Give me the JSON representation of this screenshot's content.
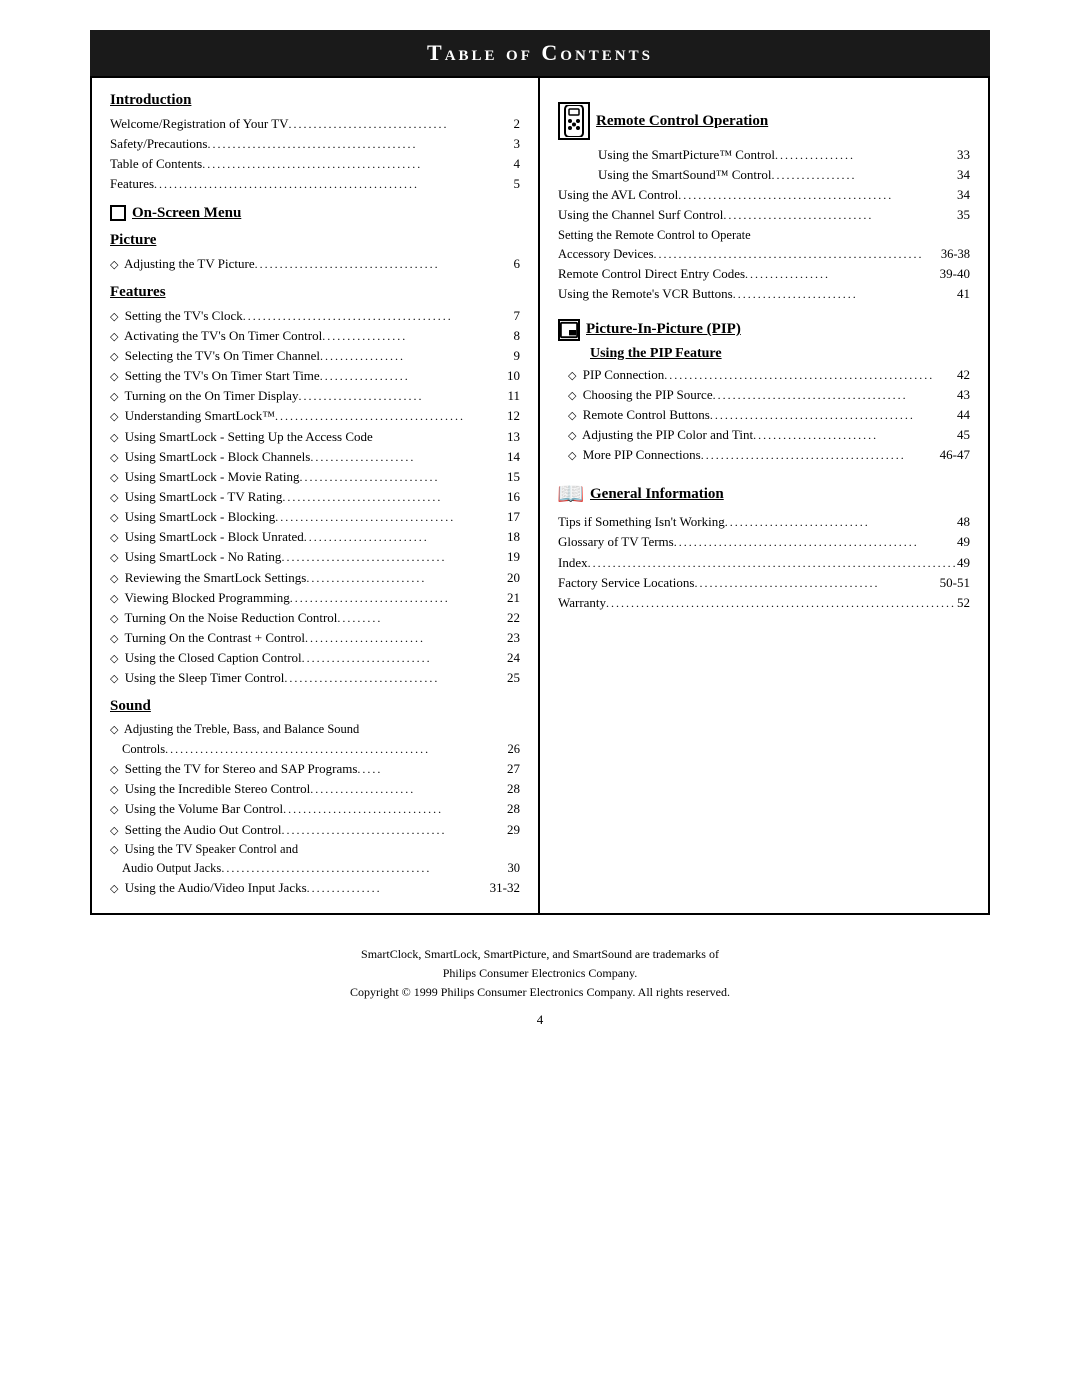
{
  "title": "Table of Contents",
  "left_column": {
    "introduction": {
      "heading": "Introduction",
      "entries": [
        {
          "text": "Welcome/Registration of Your TV",
          "dots": "................................",
          "page": "2"
        },
        {
          "text": "Safety/Precautions",
          "dots": "................................................",
          "page": "3"
        },
        {
          "text": "Table of Contents",
          "dots": "...................................................",
          "page": "4"
        },
        {
          "text": "Features",
          "dots": "................................................................",
          "page": "5"
        }
      ]
    },
    "on_screen_menu": {
      "heading": "On-Screen Menu"
    },
    "picture": {
      "heading": "Picture",
      "entries": [
        {
          "text": "◇ Adjusting the TV Picture",
          "dots": "......................................",
          "page": "6"
        }
      ]
    },
    "features": {
      "heading": "Features",
      "entries": [
        {
          "text": "◇ Setting the TV's Clock",
          "dots": "..........................................",
          "page": "7"
        },
        {
          "text": "◇ Activating the TV's On Timer Control",
          "dots": ".................",
          "page": "8"
        },
        {
          "text": "◇ Selecting the TV's On Timer Channel",
          "dots": "..................",
          "page": "9"
        },
        {
          "text": "◇ Setting the TV's On Timer Start Time",
          "dots": ".................",
          "page": "10"
        },
        {
          "text": "◇ Turning on the On Timer Display",
          "dots": ".........................",
          "page": "11"
        },
        {
          "text": "◇ Understanding SmartLock™",
          "dots": "......................................",
          "page": "12"
        },
        {
          "text": "◇ Using SmartLock - Setting Up the Access Code",
          "dots": "",
          "page": "13"
        },
        {
          "text": "◇ Using SmartLock - Block Channels",
          "dots": ".....................",
          "page": "14"
        },
        {
          "text": "◇ Using SmartLock - Movie Rating",
          "dots": "............................",
          "page": "15"
        },
        {
          "text": "◇ Using SmartLock - TV Rating",
          "dots": "................................",
          "page": "16"
        },
        {
          "text": "◇ Using SmartLock - Blocking",
          "dots": "....................................",
          "page": "17"
        },
        {
          "text": "◇ Using SmartLock - Block Unrated",
          "dots": ".........................",
          "page": "18"
        },
        {
          "text": "◇ Using SmartLock - No Rating",
          "dots": ".................................",
          "page": "19"
        },
        {
          "text": "◇ Reviewing the SmartLock Settings",
          "dots": "........................",
          "page": "20"
        },
        {
          "text": "◇ Viewing Blocked Programming",
          "dots": "................................",
          "page": "21"
        },
        {
          "text": "◇ Turning On the Noise Reduction Control",
          "dots": ".........",
          "page": "22"
        },
        {
          "text": "◇ Turning On the Contrast + Control",
          "dots": "........................",
          "page": "23"
        },
        {
          "text": "◇ Using the Closed Caption Control",
          "dots": "..........................",
          "page": "24"
        },
        {
          "text": "◇ Using the Sleep Timer Control",
          "dots": "...............................",
          "page": "25"
        }
      ]
    },
    "sound": {
      "heading": "Sound",
      "entries": [
        {
          "text": "◇ Adjusting the Treble, Bass, and Balance Sound Controls",
          "dots": "....",
          "page": "26",
          "multiline": true,
          "line2": "Controls"
        },
        {
          "text": "◇ Setting the TV for Stereo and SAP Programs",
          "dots": ".....",
          "page": "27"
        },
        {
          "text": "◇ Using the Incredible Stereo Control",
          "dots": ".....................",
          "page": "28"
        },
        {
          "text": "◇ Using the Volume Bar Control",
          "dots": "................................",
          "page": "28"
        },
        {
          "text": "◇ Setting the Audio Out Control",
          "dots": ".................................",
          "page": "29"
        },
        {
          "text": "◇ Using the TV Speaker Control and Audio Output Jacks",
          "dots": "......",
          "page": "30",
          "multiline": true,
          "line2": "Audio Output Jacks"
        },
        {
          "text": "◇ Using the Audio/Video Input Jacks",
          "dots": "...............",
          "page": "31-32"
        }
      ]
    }
  },
  "right_column": {
    "remote_control": {
      "heading": "Remote Control Operation",
      "entries": [
        {
          "text": "Using the SmartPicture™ Control",
          "dots": "................",
          "page": "33"
        },
        {
          "text": "Using the SmartSound™ Control",
          "dots": "...................",
          "page": "34"
        },
        {
          "text": "Using the AVL Control",
          "dots": "...........................................",
          "page": "34"
        },
        {
          "text": "Using the Channel Surf Control",
          "dots": "..............................",
          "page": "35"
        },
        {
          "text": "Setting the Remote Control to Operate Accessory Devices",
          "dots": "....",
          "page": "36-38",
          "multiline": true,
          "line2": "Accessory Devices"
        },
        {
          "text": "Remote Control Direct Entry Codes",
          "dots": "...................",
          "page": "39-40"
        },
        {
          "text": "Using the Remote's VCR Buttons",
          "dots": ".........................",
          "page": "41"
        }
      ]
    },
    "pip": {
      "heading": "Picture-In-Picture (PIP)",
      "sub_heading": "Using the PIP Feature",
      "entries": [
        {
          "text": "◇ PIP Connection",
          "dots": "......................................................",
          "page": "42"
        },
        {
          "text": "◇ Choosing the PIP Source",
          "dots": ".....................................",
          "page": "43"
        },
        {
          "text": "◇ Remote Control Buttons",
          "dots": ".......................................",
          "page": "44"
        },
        {
          "text": "◇ Adjusting the PIP Color and Tint",
          "dots": ".........................",
          "page": "45"
        },
        {
          "text": "◇ More PIP Connections",
          "dots": ".......................................",
          "page": "46-47"
        }
      ]
    },
    "general_info": {
      "heading": "General Information",
      "entries": [
        {
          "text": "Tips if Something Isn't Working",
          "dots": ".............................",
          "page": "48"
        },
        {
          "text": "Glossary of TV Terms",
          "dots": ".................................................",
          "page": "49"
        },
        {
          "text": "Index",
          "dots": "...........................................................................",
          "page": "49"
        },
        {
          "text": "Factory Service Locations",
          "dots": ".....................................",
          "page": "50-51"
        },
        {
          "text": "Warranty",
          "dots": "......................................................................",
          "page": "52"
        }
      ]
    }
  },
  "footnote": {
    "line1": "SmartClock, SmartLock, SmartPicture, and SmartSound are trademarks of",
    "line2": "Philips Consumer Electronics Company.",
    "line3": "Copyright © 1999 Philips Consumer Electronics Company. All rights reserved."
  },
  "page_number": "4"
}
